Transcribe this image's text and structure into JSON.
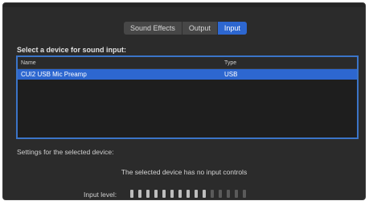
{
  "tabs": [
    {
      "label": "Sound Effects",
      "active": false
    },
    {
      "label": "Output",
      "active": false
    },
    {
      "label": "Input",
      "active": true
    }
  ],
  "device_section": {
    "heading": "Select a device for sound input:",
    "columns": {
      "name": "Name",
      "type": "Type"
    },
    "rows": [
      {
        "name": "CUI2 USB Mic Preamp",
        "type": "USB",
        "selected": true
      }
    ]
  },
  "settings": {
    "label": "Settings for the selected device:",
    "message": "The selected device has no input controls",
    "input_level_label": "Input level:",
    "input_level_segments_total": 15,
    "input_level_segments_lit": 10
  },
  "colors": {
    "accent": "#2d67d0",
    "background": "#2b2b2b"
  }
}
